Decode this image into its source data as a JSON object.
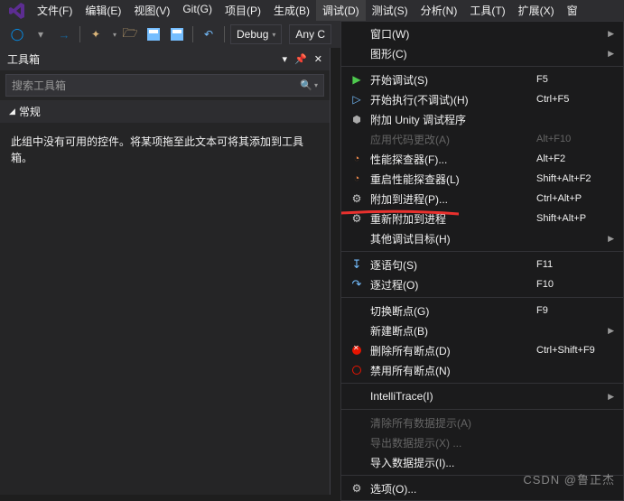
{
  "menubar": {
    "items": [
      {
        "label": "文件(F)"
      },
      {
        "label": "编辑(E)"
      },
      {
        "label": "视图(V)"
      },
      {
        "label": "Git(G)"
      },
      {
        "label": "项目(P)"
      },
      {
        "label": "生成(B)"
      },
      {
        "label": "调试(D)",
        "active": true
      },
      {
        "label": "测试(S)"
      },
      {
        "label": "分析(N)"
      },
      {
        "label": "工具(T)"
      },
      {
        "label": "扩展(X)"
      },
      {
        "label": "窗"
      }
    ]
  },
  "toolbar": {
    "config": "Debug",
    "platform": "Any C"
  },
  "panel": {
    "title": "工具箱",
    "search_placeholder": "搜索工具箱",
    "tree_root": "常规",
    "empty": "此组中没有可用的控件。将某项拖至此文本可将其添加到工具箱。"
  },
  "dropdown": [
    {
      "type": "item",
      "icon": "",
      "label": "窗口(W)",
      "sub": true
    },
    {
      "type": "item",
      "icon": "",
      "label": "图形(C)",
      "sub": true
    },
    {
      "type": "sep"
    },
    {
      "type": "item",
      "icon": "play-green",
      "label": "开始调试(S)",
      "shortcut": "F5"
    },
    {
      "type": "item",
      "icon": "play-outline",
      "label": "开始执行(不调试)(H)",
      "shortcut": "Ctrl+F5"
    },
    {
      "type": "item",
      "icon": "unity",
      "label": "附加 Unity 调试程序"
    },
    {
      "type": "item",
      "icon": "",
      "label": "应用代码更改(A)",
      "shortcut": "Alt+F10",
      "disabled": true
    },
    {
      "type": "item",
      "icon": "perf",
      "label": "性能探查器(F)...",
      "shortcut": "Alt+F2"
    },
    {
      "type": "item",
      "icon": "perf",
      "label": "重启性能探查器(L)",
      "shortcut": "Shift+Alt+F2"
    },
    {
      "type": "item",
      "icon": "gear",
      "label": "附加到进程(P)...",
      "shortcut": "Ctrl+Alt+P",
      "highlight": true
    },
    {
      "type": "item",
      "icon": "gear",
      "label": "重新附加到进程",
      "shortcut": "Shift+Alt+P"
    },
    {
      "type": "item",
      "icon": "",
      "label": "其他调试目标(H)",
      "sub": true
    },
    {
      "type": "sep"
    },
    {
      "type": "item",
      "icon": "step-into",
      "label": "逐语句(S)",
      "shortcut": "F11"
    },
    {
      "type": "item",
      "icon": "step-over",
      "label": "逐过程(O)",
      "shortcut": "F10"
    },
    {
      "type": "sep"
    },
    {
      "type": "item",
      "icon": "",
      "label": "切换断点(G)",
      "shortcut": "F9"
    },
    {
      "type": "item",
      "icon": "",
      "label": "新建断点(B)",
      "sub": true
    },
    {
      "type": "item",
      "icon": "bp-del",
      "label": "删除所有断点(D)",
      "shortcut": "Ctrl+Shift+F9"
    },
    {
      "type": "item",
      "icon": "bp-disable",
      "label": "禁用所有断点(N)"
    },
    {
      "type": "sep"
    },
    {
      "type": "item",
      "icon": "",
      "label": "IntelliTrace(I)",
      "sub": true
    },
    {
      "type": "sep"
    },
    {
      "type": "item",
      "icon": "",
      "label": "清除所有数据提示(A)",
      "disabled": true
    },
    {
      "type": "item",
      "icon": "",
      "label": "导出数据提示(X) ...",
      "disabled": true
    },
    {
      "type": "item",
      "icon": "",
      "label": "导入数据提示(I)..."
    },
    {
      "type": "sep"
    },
    {
      "type": "item",
      "icon": "gear",
      "label": "选项(O)..."
    }
  ],
  "watermark": "CSDN @鲁正杰"
}
